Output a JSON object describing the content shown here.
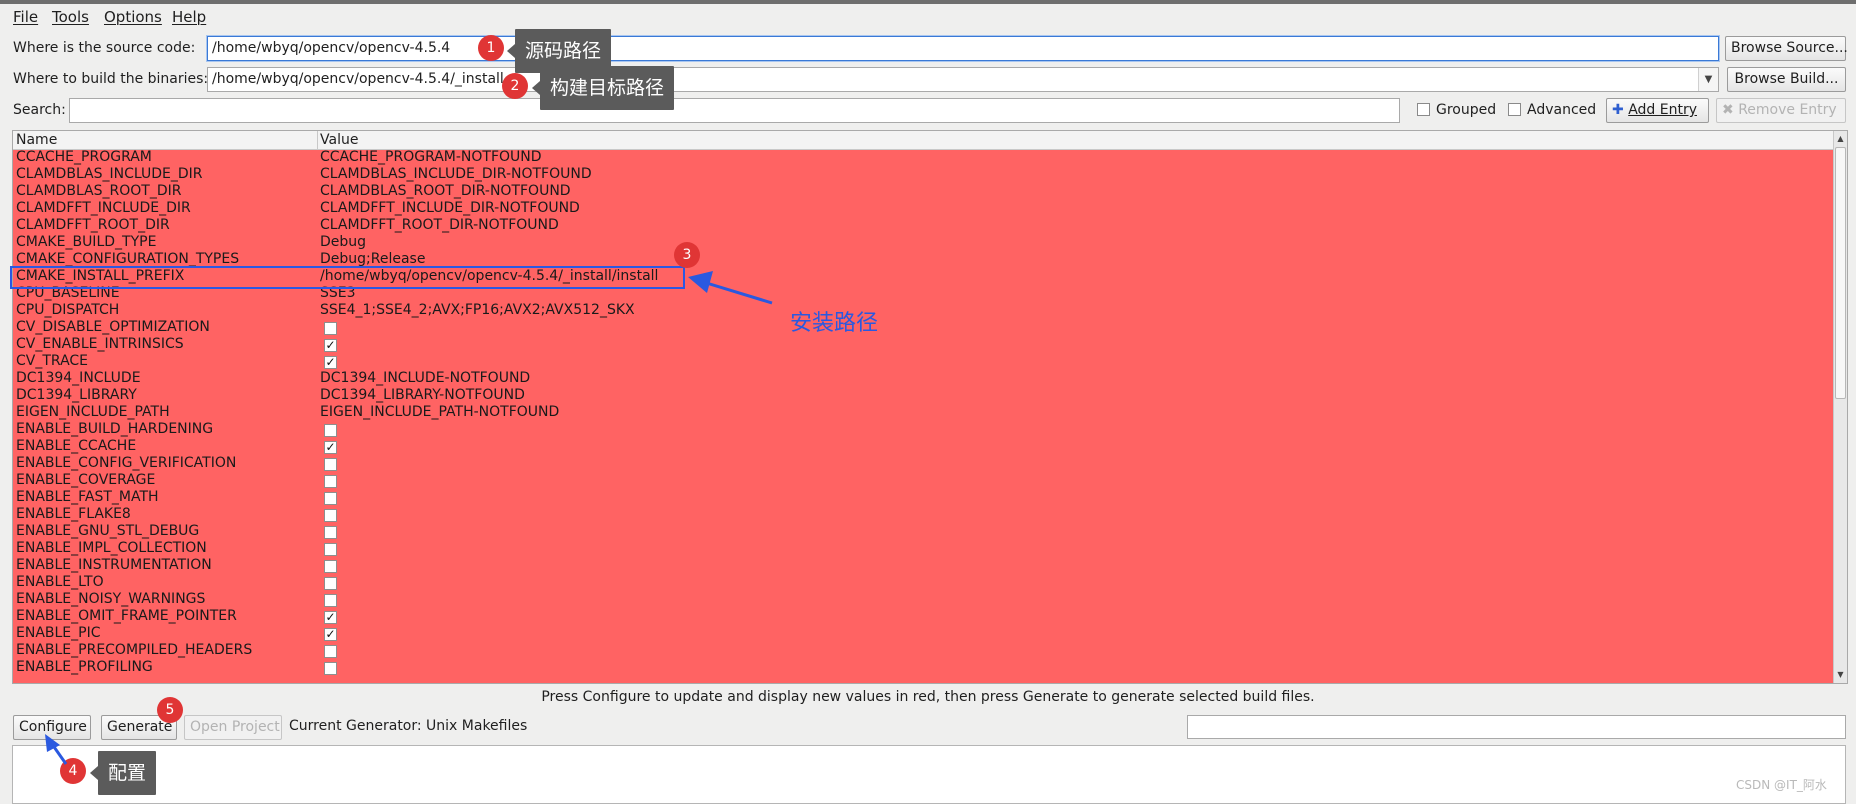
{
  "menu": [
    "File",
    "Tools",
    "Options",
    "Help"
  ],
  "source": {
    "label": "Where is the source code:",
    "value": "/home/wbyq/opencv/opencv-4.5.4",
    "button": "Browse Source..."
  },
  "build": {
    "label": "Where to build the binaries:",
    "value": "/home/wbyq/opencv/opencv-4.5.4/_install",
    "button": "Browse Build..."
  },
  "search": {
    "label": "Search:",
    "value": ""
  },
  "options": {
    "grouped": "Grouped",
    "advanced": "Advanced",
    "add_entry": "Add Entry",
    "remove_entry": "Remove Entry"
  },
  "table": {
    "headers": {
      "name": "Name",
      "value": "Value"
    },
    "rows": [
      {
        "name": "CCACHE_PROGRAM",
        "value": "CCACHE_PROGRAM-NOTFOUND",
        "type": "text"
      },
      {
        "name": "CLAMDBLAS_INCLUDE_DIR",
        "value": "CLAMDBLAS_INCLUDE_DIR-NOTFOUND",
        "type": "text"
      },
      {
        "name": "CLAMDBLAS_ROOT_DIR",
        "value": "CLAMDBLAS_ROOT_DIR-NOTFOUND",
        "type": "text"
      },
      {
        "name": "CLAMDFFT_INCLUDE_DIR",
        "value": "CLAMDFFT_INCLUDE_DIR-NOTFOUND",
        "type": "text"
      },
      {
        "name": "CLAMDFFT_ROOT_DIR",
        "value": "CLAMDFFT_ROOT_DIR-NOTFOUND",
        "type": "text"
      },
      {
        "name": "CMAKE_BUILD_TYPE",
        "value": "Debug",
        "type": "text"
      },
      {
        "name": "CMAKE_CONFIGURATION_TYPES",
        "value": "Debug;Release",
        "type": "text"
      },
      {
        "name": "CMAKE_INSTALL_PREFIX",
        "value": "/home/wbyq/opencv/opencv-4.5.4/_install/install",
        "type": "text"
      },
      {
        "name": "CPU_BASELINE",
        "value": "SSE3",
        "type": "text"
      },
      {
        "name": "CPU_DISPATCH",
        "value": "SSE4_1;SSE4_2;AVX;FP16;AVX2;AVX512_SKX",
        "type": "text"
      },
      {
        "name": "CV_DISABLE_OPTIMIZATION",
        "checked": false,
        "type": "bool"
      },
      {
        "name": "CV_ENABLE_INTRINSICS",
        "checked": true,
        "type": "bool"
      },
      {
        "name": "CV_TRACE",
        "checked": true,
        "type": "bool"
      },
      {
        "name": "DC1394_INCLUDE",
        "value": "DC1394_INCLUDE-NOTFOUND",
        "type": "text"
      },
      {
        "name": "DC1394_LIBRARY",
        "value": "DC1394_LIBRARY-NOTFOUND",
        "type": "text"
      },
      {
        "name": "EIGEN_INCLUDE_PATH",
        "value": "EIGEN_INCLUDE_PATH-NOTFOUND",
        "type": "text"
      },
      {
        "name": "ENABLE_BUILD_HARDENING",
        "checked": false,
        "type": "bool"
      },
      {
        "name": "ENABLE_CCACHE",
        "checked": true,
        "type": "bool"
      },
      {
        "name": "ENABLE_CONFIG_VERIFICATION",
        "checked": false,
        "type": "bool"
      },
      {
        "name": "ENABLE_COVERAGE",
        "checked": false,
        "type": "bool"
      },
      {
        "name": "ENABLE_FAST_MATH",
        "checked": false,
        "type": "bool"
      },
      {
        "name": "ENABLE_FLAKE8",
        "checked": false,
        "type": "bool"
      },
      {
        "name": "ENABLE_GNU_STL_DEBUG",
        "checked": false,
        "type": "bool"
      },
      {
        "name": "ENABLE_IMPL_COLLECTION",
        "checked": false,
        "type": "bool"
      },
      {
        "name": "ENABLE_INSTRUMENTATION",
        "checked": false,
        "type": "bool"
      },
      {
        "name": "ENABLE_LTO",
        "checked": false,
        "type": "bool"
      },
      {
        "name": "ENABLE_NOISY_WARNINGS",
        "checked": false,
        "type": "bool"
      },
      {
        "name": "ENABLE_OMIT_FRAME_POINTER",
        "checked": true,
        "type": "bool"
      },
      {
        "name": "ENABLE_PIC",
        "checked": true,
        "type": "bool"
      },
      {
        "name": "ENABLE_PRECOMPILED_HEADERS",
        "checked": false,
        "type": "bool"
      },
      {
        "name": "ENABLE_PROFILING",
        "checked": false,
        "type": "bool"
      }
    ],
    "row_bg": "#ff6363"
  },
  "hint": "Press Configure to update and display new values in red, then press Generate to generate selected build files.",
  "actions": {
    "configure": "Configure",
    "generate": "Generate",
    "open_project": "Open Project",
    "generator": "Current Generator: Unix Makefiles"
  },
  "annotations": {
    "badges": [
      "1",
      "2",
      "3",
      "4",
      "5"
    ],
    "tip_source": "源码路径",
    "tip_build": "构建目标路径",
    "install_label": "安装路径",
    "tip_configure": "配置",
    "accent": "#2a59e0",
    "badge_color": "#e03535"
  },
  "watermark": "CSDN @IT_阿水"
}
